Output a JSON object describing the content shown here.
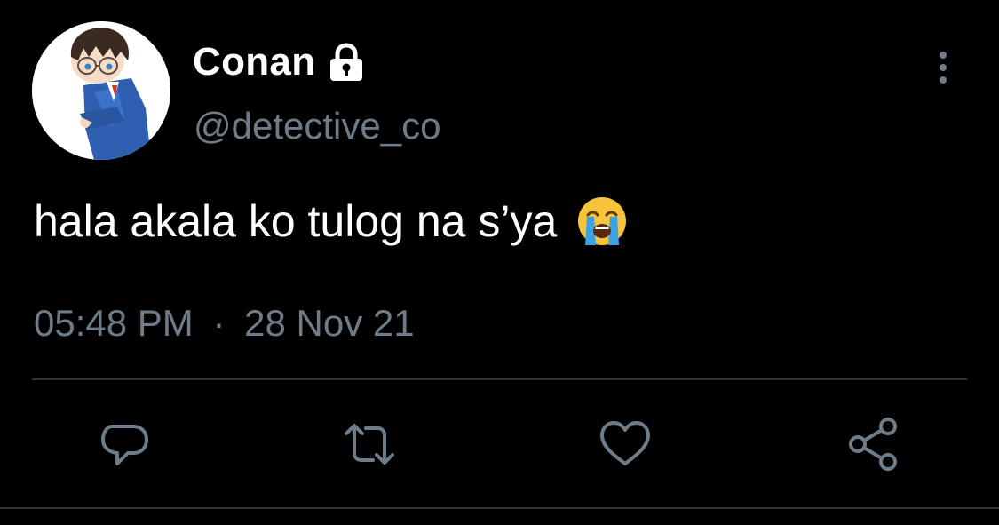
{
  "tweet": {
    "display_name": "Conan",
    "handle": "@detective_co",
    "text": "hala akala ko tulog na s’ya",
    "emoji": "loudly-crying-face",
    "time": "05:48 PM",
    "separator": "·",
    "date": "28 Nov 21",
    "protected_icon": "lock-icon",
    "more_icon": "more-vertical-icon"
  },
  "actions": [
    {
      "name": "reply",
      "icon": "comment-icon"
    },
    {
      "name": "retweet",
      "icon": "retweet-icon"
    },
    {
      "name": "like",
      "icon": "heart-icon"
    },
    {
      "name": "share",
      "icon": "share-icon"
    }
  ],
  "colors": {
    "background": "#000000",
    "primary_text": "#ffffff",
    "secondary_text": "#6e7c8a",
    "divider": "#2f3336",
    "icon": "#6e7c8a"
  }
}
